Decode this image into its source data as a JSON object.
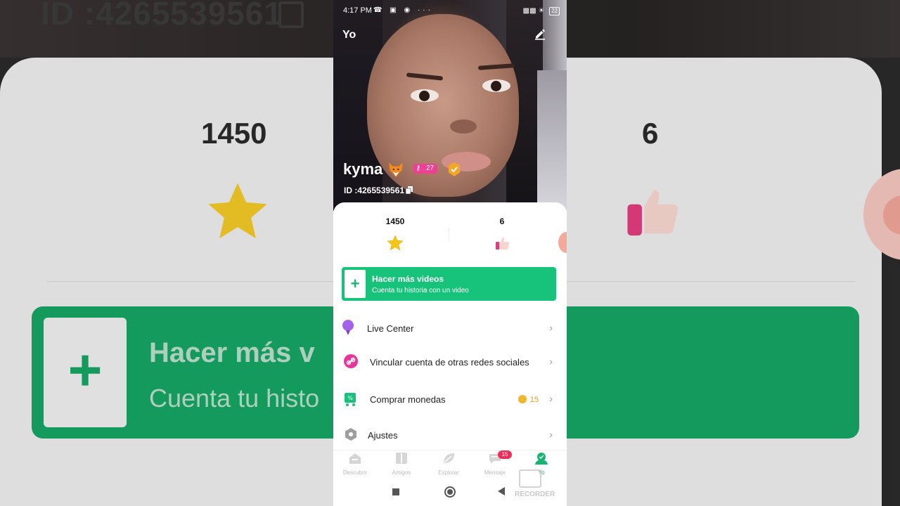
{
  "status_bar": {
    "time": "4:17 PM",
    "left_icons": "☎ ▣ ◉ ···",
    "battery": "22"
  },
  "header": {
    "title": "Yo"
  },
  "profile": {
    "name": "kyma",
    "level": "27",
    "id_text": "ID :4265539561"
  },
  "stats": {
    "stars": "1450",
    "likes": "6"
  },
  "video_card": {
    "plus": "+",
    "title": "Hacer más videos",
    "subtitle": "Cuenta tu historia con un video"
  },
  "menu": {
    "live_center": "Live Center",
    "link_social": "Vincular cuenta de otras redes sociales",
    "buy_coins": "Comprar monedas",
    "coins": "15",
    "settings": "Ajustes",
    "chevron": "›"
  },
  "tabs": {
    "discover": "Descubrir",
    "friends": "Amigos",
    "explore": "Explorar",
    "messages": "Mensaje",
    "messages_badge": "15",
    "me": "Yo"
  },
  "background": {
    "id_text": "ID :4265539561",
    "stars": "1450",
    "likes": "6",
    "card_title": "Hacer más v",
    "card_sub": "Cuenta tu histo"
  },
  "watermark": {
    "text": "RECORDER"
  },
  "colors": {
    "accent": "#17c27a",
    "badge": "#ee2d58",
    "level": "#ee3f92"
  }
}
